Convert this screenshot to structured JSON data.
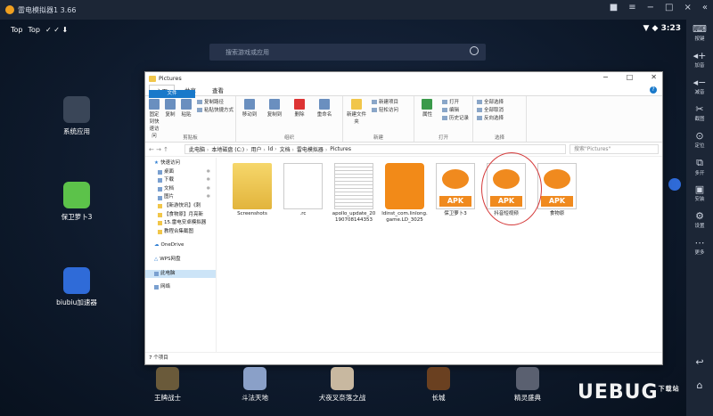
{
  "emulator": {
    "title": "雷电模拟器1 3.66",
    "status_left": [
      "Top",
      "Top"
    ],
    "time": "3:23",
    "search_placeholder": "搜索游戏或应用",
    "sidebar": [
      "按键",
      "加音",
      "减音",
      "截图",
      "定位",
      "多开",
      "安装",
      "设置",
      "更多"
    ]
  },
  "desktop_apps": [
    {
      "label": "系统应用"
    },
    {
      "label": "保卫萝卜3"
    },
    {
      "label": "biubiu加速器"
    }
  ],
  "dock": [
    "王牌战士",
    "斗法天地",
    "犬夜叉奈落之战",
    "长城",
    "精灵盛典"
  ],
  "explorer": {
    "title": "Pictures",
    "tabs": [
      "文件",
      "主页",
      "共享",
      "查看"
    ],
    "ribbon": {
      "clipboard": {
        "label": "剪贴板",
        "items": [
          "固定到快速访问",
          "复制",
          "粘贴",
          "剪切",
          "复制路径",
          "粘贴快捷方式"
        ]
      },
      "organize": {
        "label": "组织",
        "items": [
          "移动到",
          "复制到",
          "删除",
          "重命名"
        ]
      },
      "new": {
        "label": "新建",
        "items": [
          "新建文件夹",
          "新建项目",
          "轻松访问"
        ]
      },
      "open": {
        "label": "打开",
        "items": [
          "属性",
          "打开",
          "编辑",
          "历史记录"
        ]
      },
      "select": {
        "label": "选择",
        "items": [
          "全部选择",
          "全部取消",
          "反向选择"
        ]
      }
    },
    "path": [
      "此电脑",
      "本地磁盘 (C:)",
      "用户",
      "ld",
      "文档",
      "雷电模拟器",
      "Pictures"
    ],
    "search_placeholder": "搜索\"Pictures\"",
    "nav": {
      "quick_access": "快速访问",
      "items": [
        "桌面",
        "下载",
        "文档",
        "图片",
        "【新游快讯】《刺",
        "【食物原】月亮新",
        "15.雷电安卓模拟器",
        "教程合集截图"
      ],
      "onedrive": "OneDrive",
      "wps": "WPS网盘",
      "this_pc": "此电脑",
      "network": "网络"
    },
    "files": [
      {
        "name": "Screenshots",
        "kind": "folder"
      },
      {
        "name": ".rc",
        "kind": "blank"
      },
      {
        "name": "apollo_update_20190708144353",
        "kind": "doc"
      },
      {
        "name": "ldinst_com.linlong.game.LD_3025",
        "kind": "ld"
      },
      {
        "name": "保卫萝卜3",
        "kind": "apk"
      },
      {
        "name": "抖音短视频",
        "kind": "apk"
      },
      {
        "name": "食物原",
        "kind": "apk"
      }
    ],
    "status": "7 个项目"
  },
  "watermark": "UEBUG",
  "watermark_sub": "下载站"
}
